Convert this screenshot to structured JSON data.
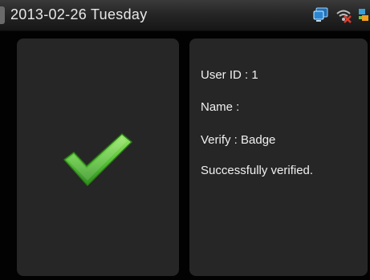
{
  "status_bar": {
    "date_text": "2013-02-26 Tuesday",
    "icons": [
      "network-icon",
      "wifi-off-icon",
      "connection-icon"
    ]
  },
  "result_panel": {
    "icon": "checkmark-icon",
    "icon_color": "#5cc43a"
  },
  "info_panel": {
    "user_id": "User ID : 1",
    "name": "Name :",
    "verify": "Verify : Badge",
    "status": "Successfully verified."
  }
}
